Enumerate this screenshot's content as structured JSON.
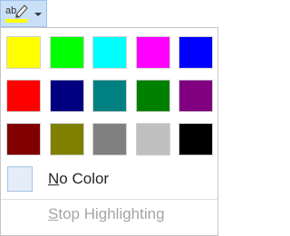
{
  "toolbar": {
    "button_icon": "highlighter-icon",
    "dropdown_icon": "chevron-down-icon",
    "current_color": "#ffff00"
  },
  "palette": {
    "rows": [
      [
        {
          "name": "Yellow",
          "color": "#ffff00"
        },
        {
          "name": "Bright Green",
          "color": "#00ff00"
        },
        {
          "name": "Turquoise",
          "color": "#00ffff"
        },
        {
          "name": "Pink",
          "color": "#ff00ff"
        },
        {
          "name": "Blue",
          "color": "#0000ff"
        }
      ],
      [
        {
          "name": "Red",
          "color": "#ff0000"
        },
        {
          "name": "Dark Blue",
          "color": "#000080"
        },
        {
          "name": "Teal",
          "color": "#008080"
        },
        {
          "name": "Green",
          "color": "#008000"
        },
        {
          "name": "Violet",
          "color": "#800080"
        }
      ],
      [
        {
          "name": "Dark Red",
          "color": "#800000"
        },
        {
          "name": "Dark Yellow",
          "color": "#808000"
        },
        {
          "name": "Gray-50%",
          "color": "#808080"
        },
        {
          "name": "Gray-25%",
          "color": "#c0c0c0"
        },
        {
          "name": "Black",
          "color": "#000000"
        }
      ]
    ]
  },
  "no_color": {
    "label_accel": "N",
    "label_rest": "o Color"
  },
  "stop_highlighting": {
    "label_accel": "S",
    "label_rest": "top Highlighting",
    "enabled": false
  }
}
